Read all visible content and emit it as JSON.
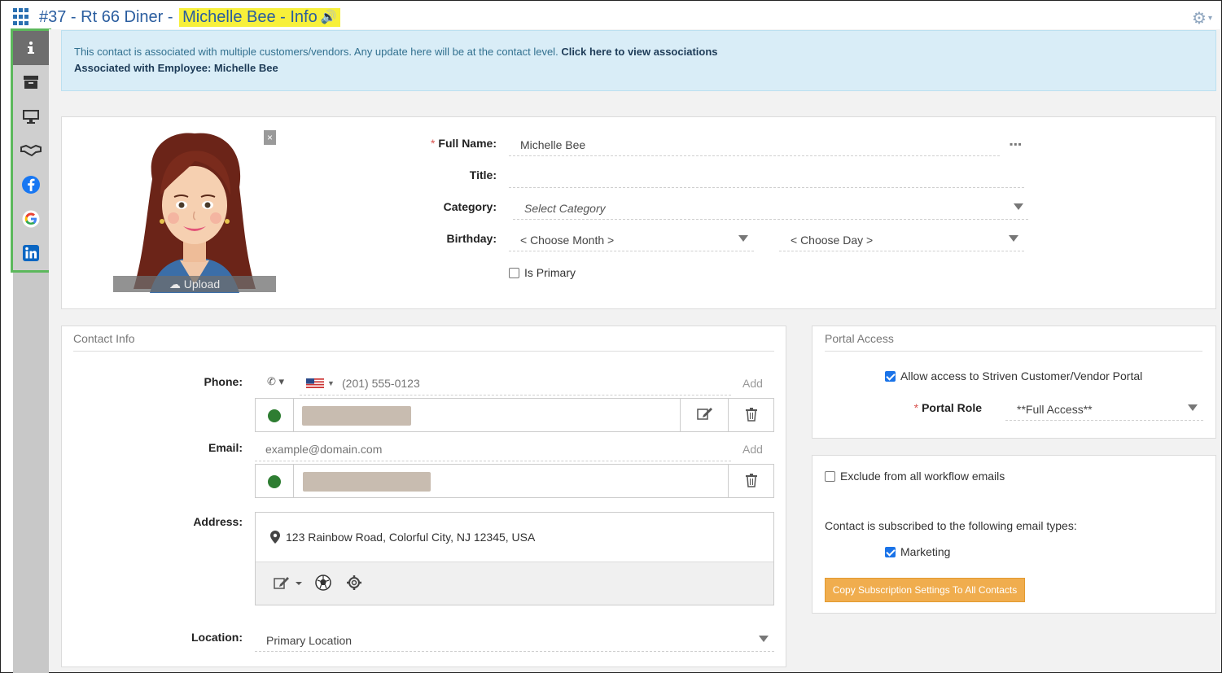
{
  "header": {
    "title_prefix": "#37 - Rt 66 Diner - ",
    "title_highlight": "Michelle Bee - Info"
  },
  "rail": {
    "items": [
      {
        "icon": "info-icon"
      },
      {
        "icon": "archive-icon"
      },
      {
        "icon": "monitor-icon"
      },
      {
        "icon": "handshake-icon"
      },
      {
        "icon": "facebook-icon"
      },
      {
        "icon": "google-icon"
      },
      {
        "icon": "linkedin-icon"
      }
    ]
  },
  "alert": {
    "text": "This contact is associated with multiple customers/vendors. Any update here will be at the contact level.",
    "link": "Click here to view associations",
    "employee": "Associated with Employee: Michelle Bee"
  },
  "profile": {
    "upload_label": "Upload",
    "close_label": "×",
    "full_name_label": "Full Name:",
    "full_name_value": "Michelle Bee",
    "title_label": "Title:",
    "title_value": "",
    "category_label": "Category:",
    "category_placeholder": "Select Category",
    "birthday_label": "Birthday:",
    "month_placeholder": "< Choose Month >",
    "day_placeholder": "< Choose Day >",
    "is_primary_label": "Is Primary",
    "is_primary_checked": false
  },
  "contact_info": {
    "section_title": "Contact Info",
    "phone_label": "Phone:",
    "phone_placeholder": "(201) 555-0123",
    "phone_add": "Add",
    "email_label": "Email:",
    "email_placeholder": "example@domain.com",
    "email_add": "Add",
    "address_label": "Address:",
    "address_value": "123 Rainbow Road, Colorful City, NJ 12345, USA",
    "location_label": "Location:",
    "location_value": "Primary Location"
  },
  "portal": {
    "section_title": "Portal Access",
    "allow_label": "Allow access to Striven Customer/Vendor Portal",
    "allow_checked": true,
    "role_label": "Portal Role",
    "role_value": "**Full Access**"
  },
  "email_prefs": {
    "exclude_label": "Exclude from all workflow emails",
    "exclude_checked": false,
    "subscribed_text": "Contact is subscribed to the following email types:",
    "marketing_label": "Marketing",
    "marketing_checked": true,
    "copy_button": "Copy Subscription Settings To All Contacts"
  },
  "colors": {
    "accent": "#2a5d9f",
    "highlight": "#f7f03a",
    "rail_border": "#5cb85c",
    "alert_bg": "#d9edf7",
    "button": "#f0ad4e"
  }
}
